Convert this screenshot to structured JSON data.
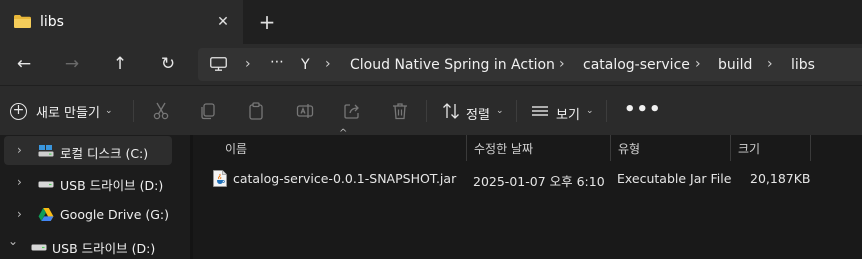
{
  "tab": {
    "title": "libs",
    "close": "✕",
    "new_tab": "+"
  },
  "nav": {
    "back": "←",
    "forward": "→",
    "up": "↑",
    "refresh": "↻",
    "sep": "›",
    "overflow": "⋯",
    "breadcrumbs": [
      "Y",
      "Cloud Native Spring in Action",
      "catalog-service",
      "build",
      "libs"
    ]
  },
  "commands": {
    "new_label": "새로 만들기",
    "new_plus": "+",
    "sort_label": "정렬",
    "view_label": "보기",
    "chev": "⌄",
    "more": "•••"
  },
  "sidebar": {
    "items": [
      {
        "label": "로컬 디스크 (C:)",
        "chevron": "›",
        "icon": "local-disk-icon"
      },
      {
        "label": "USB 드라이브 (D:)",
        "chevron": "›",
        "icon": "usb-drive-icon"
      },
      {
        "label": "Google Drive (G:)",
        "chevron": "›",
        "icon": "google-drive-icon"
      },
      {
        "label": "USB 드라이브 (D:)",
        "chevron": "⌄",
        "icon": "usb-drive-icon"
      }
    ]
  },
  "columns": {
    "name": "이름",
    "modified": "수정한 날짜",
    "type": "유형",
    "size": "크기",
    "sort_caret": "^"
  },
  "files": [
    {
      "name": "catalog-service-0.0.1-SNAPSHOT.jar",
      "modified": "2025-01-07 오후 6:10",
      "type": "Executable Jar File",
      "size": "20,187KB",
      "icon": "java-jar-icon"
    }
  ],
  "colors": {
    "folder": "#f0c24a",
    "accent": "#4cc2ff",
    "background": "#191919"
  }
}
